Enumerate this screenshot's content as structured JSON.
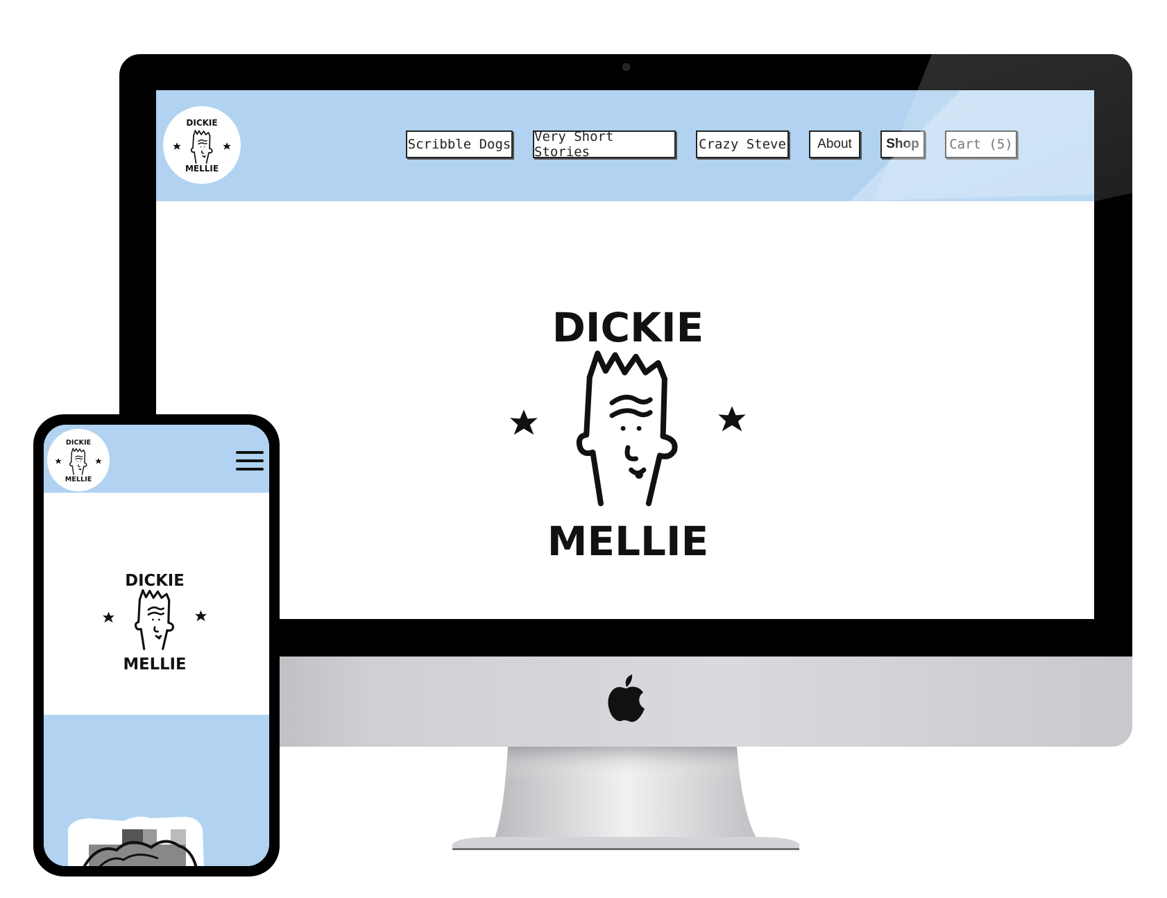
{
  "site": {
    "logo_text_top": "DICKIE",
    "logo_text_bottom": "MELLIE"
  },
  "nav": {
    "items": [
      {
        "label": "Scribble Dogs"
      },
      {
        "label": "Very Short Stories"
      },
      {
        "label": "Crazy Steve"
      },
      {
        "label": "About"
      },
      {
        "label": "Shop"
      },
      {
        "label": "Cart (5)"
      }
    ]
  },
  "colors": {
    "header_bg": "#b1d3f1",
    "ink": "#111111"
  },
  "icons": {
    "menu": "hamburger-icon",
    "brand": "apple-logo-icon"
  }
}
